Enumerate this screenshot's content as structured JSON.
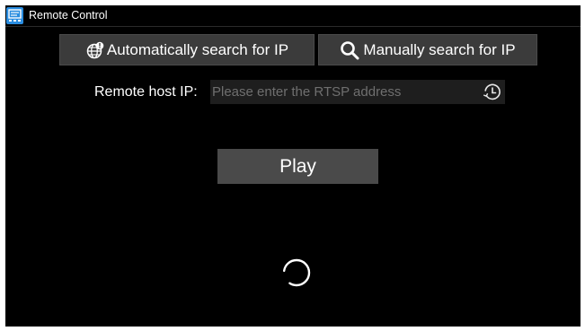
{
  "window": {
    "title": "Remote Control",
    "app_icon": "remote-control-app-icon"
  },
  "search": {
    "auto_label": "Automatically search for IP",
    "auto_icon": "globe-search-icon",
    "manual_label": "Manually search for IP",
    "manual_icon": "magnifier-icon"
  },
  "host": {
    "label": "Remote host IP:",
    "value": "",
    "placeholder": "Please enter the RTSP address",
    "history_icon": "history-clock-icon"
  },
  "play": {
    "label": "Play"
  },
  "status": {
    "loading_icon": "loading-spinner-icon"
  },
  "colors": {
    "background": "#000000",
    "button": "#3b3b3b",
    "play_button": "#4a4a4a",
    "input_background": "#1e1e1e",
    "placeholder": "#6f6f6f",
    "app_icon": "#2a8de0"
  }
}
